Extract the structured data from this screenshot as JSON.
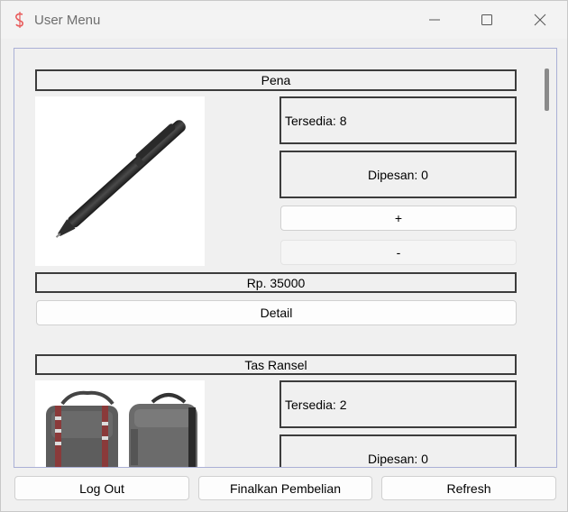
{
  "window": {
    "title": "User Menu",
    "icon": "app-logo-icon",
    "controls": [
      "minimize-icon",
      "maximize-icon",
      "close-icon"
    ]
  },
  "products": [
    {
      "name": "Pena",
      "stock_label": "Tersedia: 8",
      "ordered_label": "Dipesan: 0",
      "plus_label": "+",
      "minus_label": "-",
      "price": "Rp. 35000",
      "detail_label": "Detail",
      "image": "pen-image"
    },
    {
      "name": "Tas Ransel",
      "stock_label": "Tersedia: 2",
      "ordered_label": "Dipesan: 0",
      "image": "backpack-image"
    }
  ],
  "footer": {
    "logout_label": "Log Out",
    "finalize_label": "Finalkan Pembelian",
    "refresh_label": "Refresh"
  },
  "colors": {
    "window_bg": "#f0f0f0",
    "border_dark": "#3c3c3c",
    "client_border": "#aab0d6",
    "icon_accent": "#e85a5a"
  }
}
